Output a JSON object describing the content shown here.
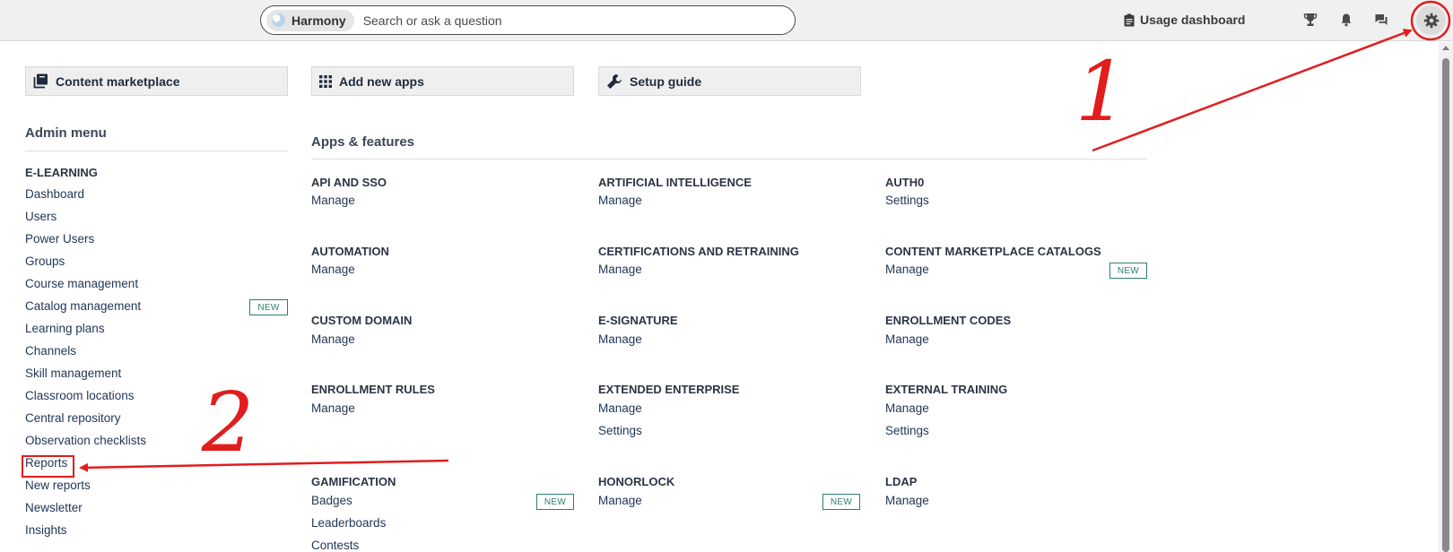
{
  "topbar": {
    "harmony_label": "Harmony",
    "search_placeholder": "Search or ask a question",
    "usage_label": "Usage dashboard",
    "icons": [
      "trophy-icon",
      "bell-icon",
      "chat-icon",
      "gear-icon"
    ]
  },
  "quick_actions": [
    {
      "label": "Content marketplace",
      "icon": "book-icon"
    },
    {
      "label": "Add new apps",
      "icon": "grid-icon"
    },
    {
      "label": "Setup guide",
      "icon": "wrench-icon"
    }
  ],
  "admin_menu": {
    "title": "Admin menu",
    "section": "E-LEARNING",
    "items": [
      {
        "label": "Dashboard"
      },
      {
        "label": "Users"
      },
      {
        "label": "Power Users"
      },
      {
        "label": "Groups"
      },
      {
        "label": "Course management"
      },
      {
        "label": "Catalog management",
        "badge": "NEW"
      },
      {
        "label": "Learning plans"
      },
      {
        "label": "Channels"
      },
      {
        "label": "Skill management"
      },
      {
        "label": "Classroom locations"
      },
      {
        "label": "Central repository"
      },
      {
        "label": "Observation checklists"
      },
      {
        "label": "Reports"
      },
      {
        "label": "New reports"
      },
      {
        "label": "Newsletter"
      },
      {
        "label": "Insights"
      }
    ]
  },
  "apps": {
    "title": "Apps & features",
    "list": [
      {
        "name": "API AND SSO",
        "links": [
          "Manage"
        ]
      },
      {
        "name": "ARTIFICIAL INTELLIGENCE",
        "links": [
          "Manage"
        ]
      },
      {
        "name": "AUTH0",
        "links": [
          "Settings"
        ]
      },
      {
        "name": "AUTOMATION",
        "links": [
          "Manage"
        ]
      },
      {
        "name": "CERTIFICATIONS AND RETRAINING",
        "links": [
          "Manage"
        ]
      },
      {
        "name": "CONTENT MARKETPLACE CATALOGS",
        "links": [
          "Manage"
        ],
        "badge": "NEW"
      },
      {
        "name": "CUSTOM DOMAIN",
        "links": [
          "Manage"
        ]
      },
      {
        "name": "E-SIGNATURE",
        "links": [
          "Manage"
        ]
      },
      {
        "name": "ENROLLMENT CODES",
        "links": [
          "Manage"
        ]
      },
      {
        "name": "ENROLLMENT RULES",
        "links": [
          "Manage"
        ]
      },
      {
        "name": "EXTENDED ENTERPRISE",
        "links": [
          "Manage",
          "Settings"
        ]
      },
      {
        "name": "EXTERNAL TRAINING",
        "links": [
          "Manage",
          "Settings"
        ]
      },
      {
        "name": "GAMIFICATION",
        "links": [
          "Badges",
          "Leaderboards",
          "Contests"
        ],
        "badge": "NEW"
      },
      {
        "name": "HONORLOCK",
        "links": [
          "Manage"
        ],
        "badge": "NEW"
      },
      {
        "name": "LDAP",
        "links": [
          "Manage"
        ]
      }
    ]
  },
  "annotations": {
    "marker_1": "1",
    "marker_2": "2",
    "color": "#e11d1d"
  }
}
